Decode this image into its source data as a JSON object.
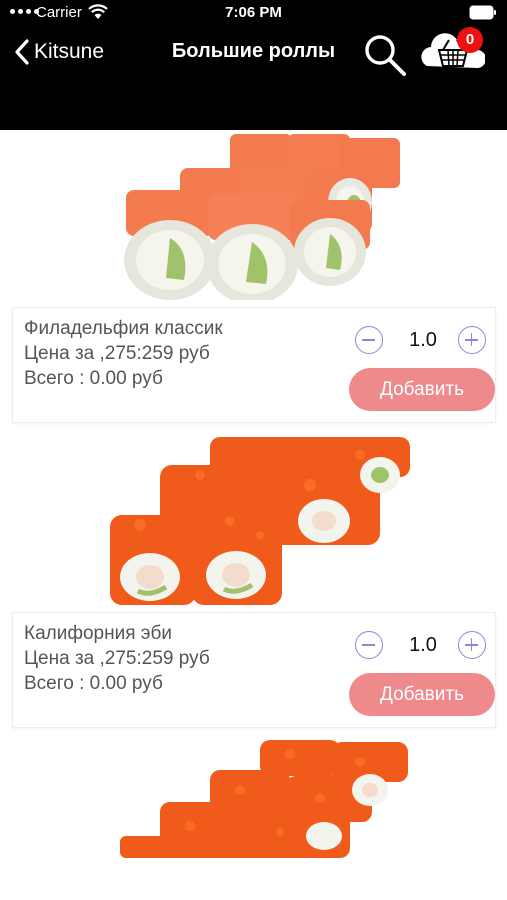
{
  "status_bar": {
    "carrier": "Carrier",
    "time": "7:06 PM"
  },
  "nav": {
    "back_label": "Kitsune",
    "title": "Большие роллы",
    "cart_count": "0"
  },
  "products": [
    {
      "name": "Филадельфия классик",
      "price": "Цена за ,275:259 руб",
      "total": "Всего : 0.00 руб",
      "quantity": "1.0",
      "add_label": "Добавить",
      "image": "philadelphia-roll-image"
    },
    {
      "name": "Калифорния эби",
      "price": "Цена за ,275:259 руб",
      "total": "Всего : 0.00 руб",
      "quantity": "1.0",
      "add_label": "Добавить",
      "image": "california-ebi-roll-image"
    },
    {
      "image": "california-roll-image"
    }
  ],
  "colors": {
    "bar": "#000000",
    "accent": "#8e86d8",
    "add_button": "#ee8a8b",
    "badge": "#ee1111"
  }
}
